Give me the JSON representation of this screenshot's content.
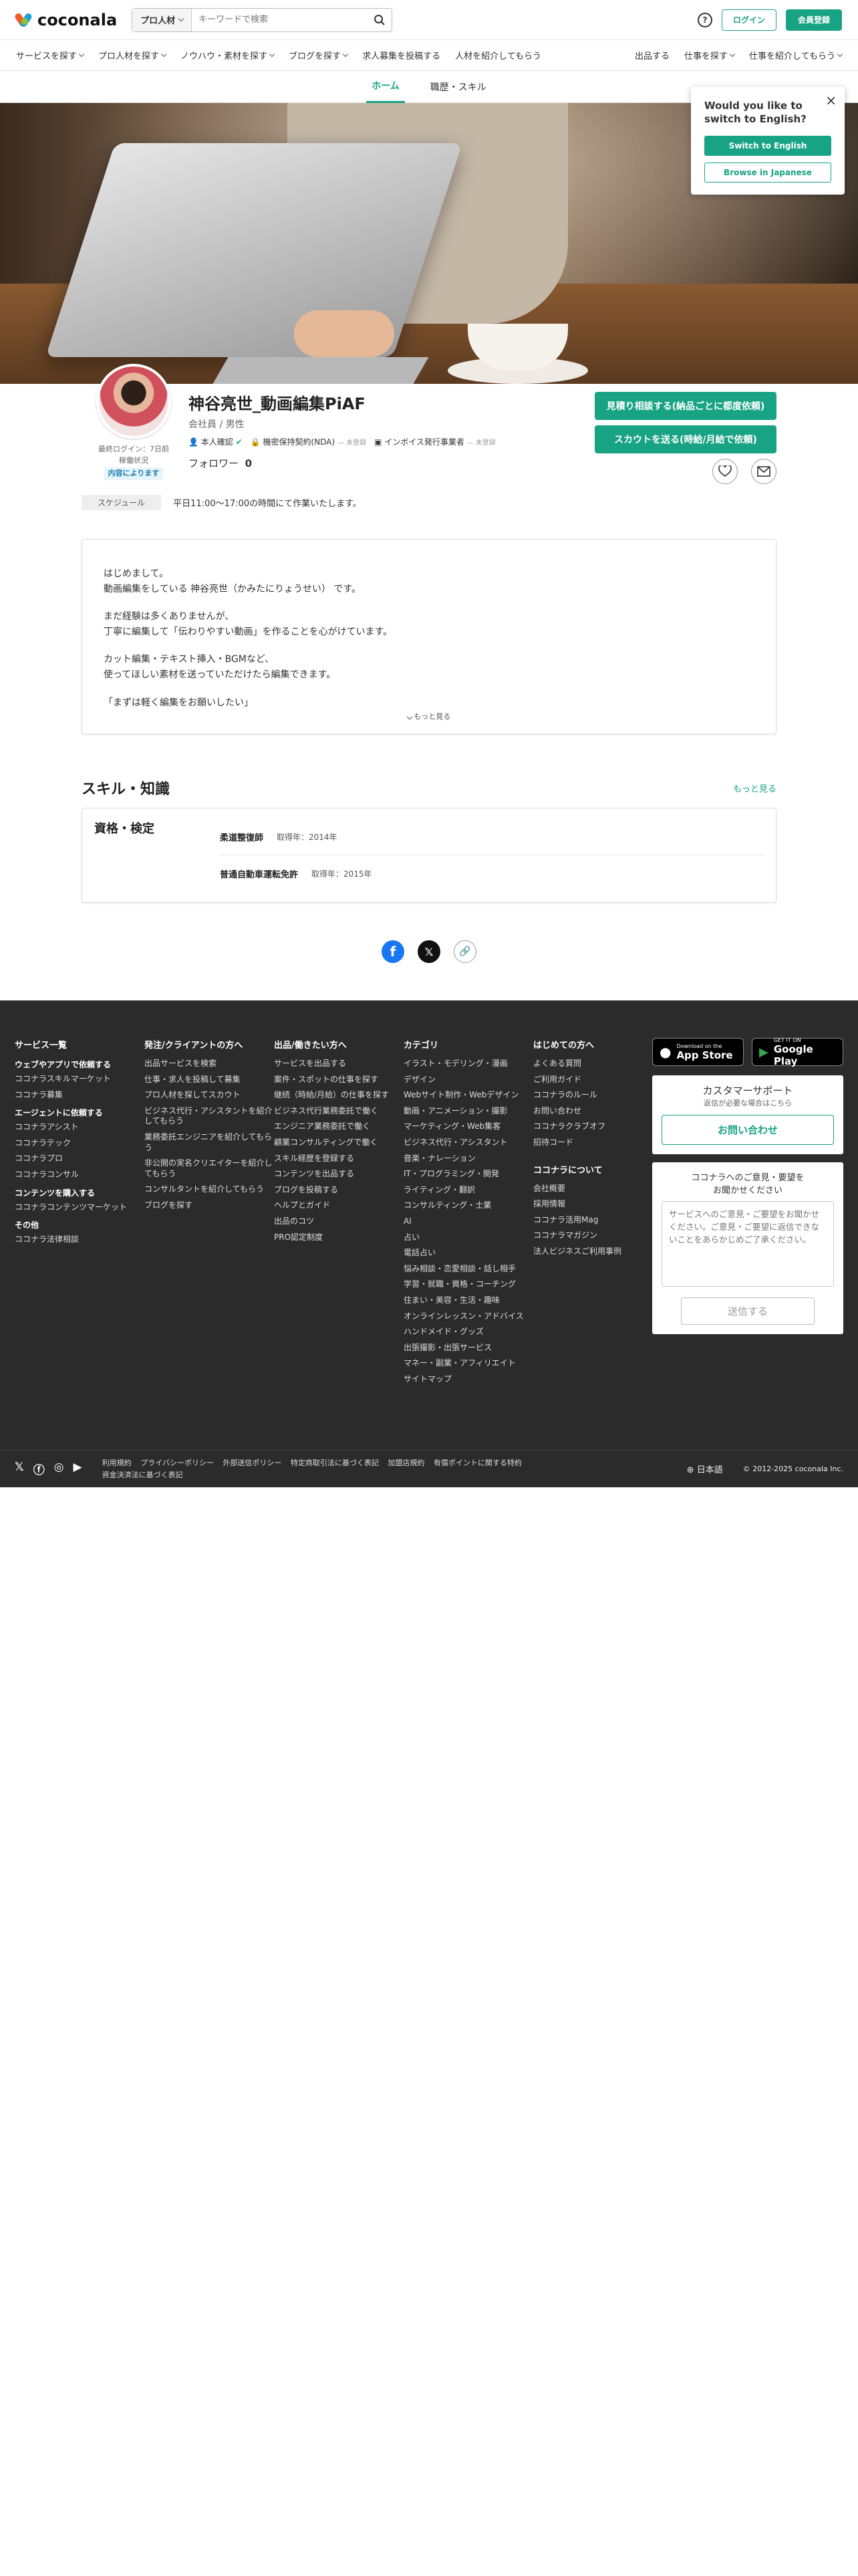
{
  "header": {
    "logo_text": "coconala",
    "search_category": "プロ人材",
    "search_placeholder": "キーワードで検索",
    "login_label": "ログイン",
    "signup_label": "会員登録",
    "help_label": "?"
  },
  "nav": {
    "left": [
      "サービスを探す",
      "プロ人材を探す",
      "ノウハウ・素材を探す",
      "ブログを探す",
      "求人募集を投稿する",
      "人材を紹介してもらう"
    ],
    "right": [
      "出品する",
      "仕事を探す",
      "仕事を紹介してもらう"
    ]
  },
  "subtabs": [
    "ホーム",
    "職歴・スキル"
  ],
  "lang_popup": {
    "title": "Would you like to switch to English?",
    "switch_label": "Switch to English",
    "browse_label": "Browse in Japanese"
  },
  "profile": {
    "name": "神谷亮世_動画編集PiAF",
    "role": "会社員 / 男性",
    "identity_label": "本人確認",
    "nda_label": "機密保持契約(NDA)",
    "nda_status": "— 未登録",
    "invoice_label": "インボイス発行事業者",
    "invoice_status": "— 未登録",
    "follow_label": "フォロワー",
    "follow_count": "0",
    "last_login": "最終ログイン：7日前",
    "status_label": "稼働状況",
    "status_badge": "内容によります",
    "cta_estimate": "見積り相談する(納品ごとに都度依頼)",
    "cta_scout": "スカウトを送る(時給/月給で依頼)",
    "schedule_label": "スケジュール",
    "schedule_text": "平日11:00〜17:00の時間にて作業いたします。"
  },
  "intro": {
    "p1": "はじめまして。",
    "p1b": "動画編集をしている 神谷亮世（かみたにりょうせい） です。",
    "p2": "まだ経験は多くありませんが、",
    "p2b": "丁寧に編集して「伝わりやすい動画」を作ることを心がけています。",
    "p3": "カット編集・テキスト挿入・BGMなど、",
    "p3b": "使ってほしい素材を送っていただけたら編集できます。",
    "p4": "「まずは軽く編集をお願いしたい」",
    "more_label": "もっと見る"
  },
  "skills": {
    "section_title": "スキル・知識",
    "more_label": "もっと見る",
    "card_title": "資格・検定",
    "items": [
      {
        "name": "柔道整復師",
        "year": "取得年：2014年"
      },
      {
        "name": "普通自動車運転免許",
        "year": "取得年：2015年"
      }
    ]
  },
  "footer": {
    "col1": {
      "title": "サービス一覧",
      "g1": "ウェブやアプリで依頼する",
      "g1_items": [
        "ココナラスキルマーケット",
        "ココナラ募集"
      ],
      "g2": "エージェントに依頼する",
      "g2_items": [
        "ココナラアシスト",
        "ココナラテック",
        "ココナラプロ",
        "ココナラコンサル"
      ],
      "g3": "コンテンツを購入する",
      "g3_items": [
        "ココナラコンテンツマーケット"
      ],
      "g4": "その他",
      "g4_items": [
        "ココナラ法律相談"
      ]
    },
    "col2": {
      "title": "発注/クライアントの方へ",
      "items": [
        "出品サービスを検索",
        "仕事・求人を投稿して募集",
        "プロ人材を探してスカウト",
        "ビジネス代行・アシスタントを紹介してもらう",
        "業務委託エンジニアを紹介してもらう",
        "非公開の実名クリエイターを紹介してもらう",
        "コンサルタントを紹介してもらう",
        "ブログを探す"
      ]
    },
    "col3": {
      "title": "出品/働きたい方へ",
      "items": [
        "サービスを出品する",
        "案件・スポットの仕事を探す",
        "継続（時給/月給）の仕事を探す",
        "ビジネス代行業務委託で働く",
        "エンジニア業務委託で働く",
        "顧業コンサルティングで働く",
        "スキル経歴を登録する",
        "コンテンツを出品する",
        "ブログを投稿する",
        "ヘルプとガイド",
        "出品のコツ",
        "PRO認定制度"
      ]
    },
    "col4": {
      "title": "カテゴリ",
      "items": [
        "イラスト・モデリング・漫画",
        "デザイン",
        "Webサイト制作・Webデザイン",
        "動画・アニメーション・撮影",
        "マーケティング・Web集客",
        "ビジネス代行・アシスタント",
        "音楽・ナレーション",
        "IT・プログラミング・開発",
        "ライティング・翻訳",
        "コンサルティング・士業",
        "AI",
        "占い",
        "電話占い",
        "悩み相談・恋愛相談・話し相手",
        "学習・就職・資格・コーチング",
        "住まい・美容・生活・趣味",
        "オンラインレッスン・アドバイス",
        "ハンドメイド・グッズ",
        "出張撮影・出張サービス",
        "マネー・副業・アフィリエイト",
        "サイトマップ"
      ]
    },
    "col5": {
      "title": "はじめての方へ",
      "items": [
        "よくある質問",
        "ご利用ガイド",
        "ココナラのルール",
        "お問い合わせ",
        "ココナラクラブオフ",
        "招待コード"
      ],
      "title2": "ココナラについて",
      "items2": [
        "会社概要",
        "採用情報",
        "ココナラ活用Mag",
        "ココナラマガジン",
        "法人ビジネスご利用事例"
      ]
    },
    "app_store_small": "Download on the",
    "app_store": "App Store",
    "google_small": "GET IT ON",
    "google_play": "Google Play",
    "support_title": "カスタマーサポート",
    "support_sub": "返信が必要な場合はこちら",
    "support_btn": "お問い合わせ",
    "feedback_title": "ココナラへのご意見・要望を",
    "feedback_title2": "お聞かせください",
    "feedback_placeholder": "サービスへのご意見・ご要望をお聞かせください。ご意見・ご要望に返信できないことをあらかじめご了承ください。",
    "feedback_send": "送信する",
    "bottom_links": [
      "利用規約",
      "プライバシーポリシー",
      "外部送信ポリシー",
      "特定商取引法に基づく表記",
      "加盟店規約",
      "有償ポイントに関する特約",
      "資金決済法に基づく表記"
    ],
    "language": "日本語",
    "copyright": "© 2012-2025 coconala Inc."
  }
}
